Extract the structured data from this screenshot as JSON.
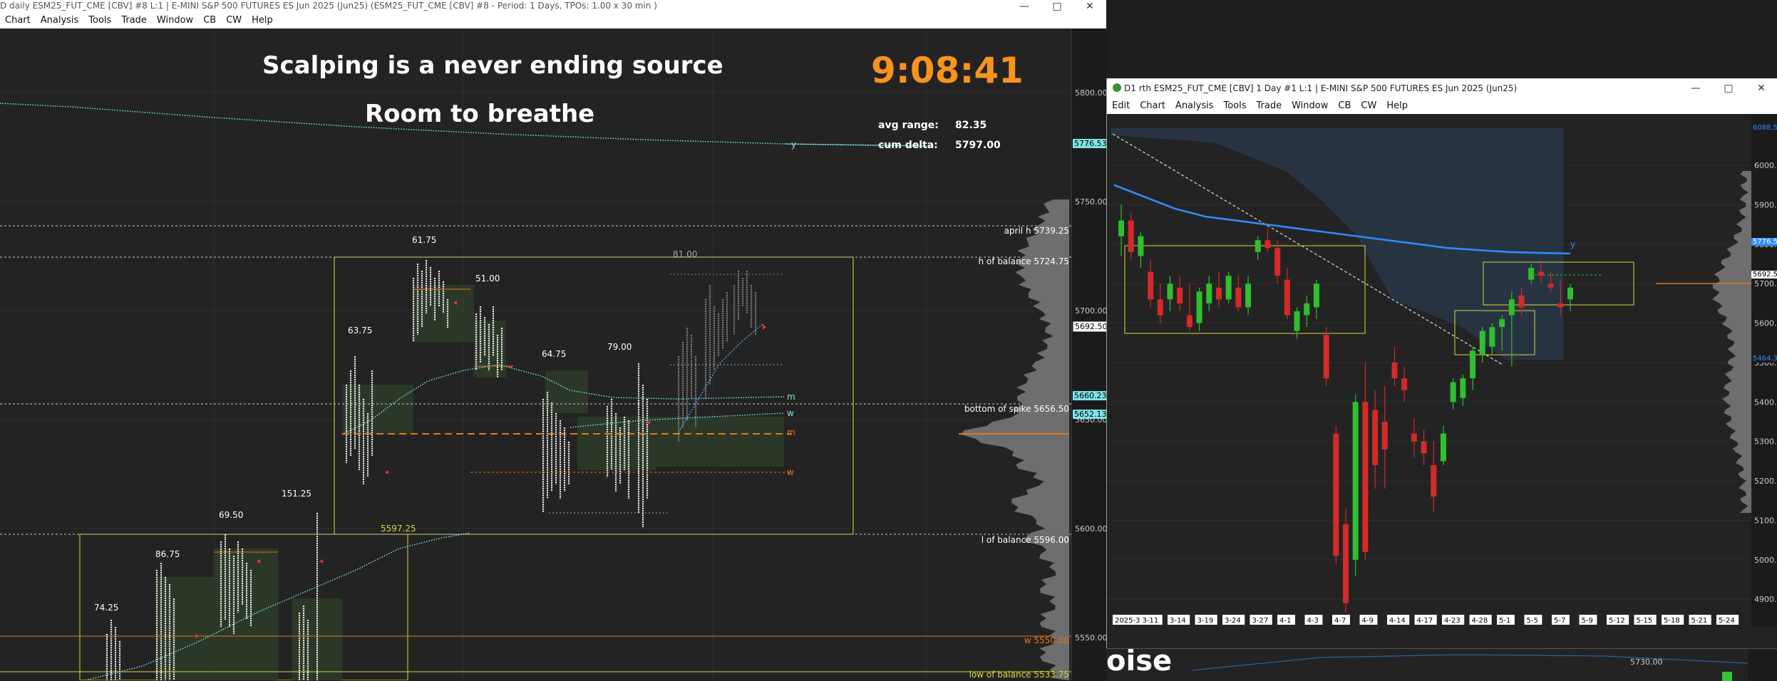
{
  "left_window": {
    "title": "D daily ESM25_FUT_CME [CBV] #8 L:1 | E-MINI S&P 500 FUTURES ES Jun 2025 (Jun25) (ESM25_FUT_CME [CBV] #8 - Period: 1 Days, TPOs: 1.00 x 30 min )",
    "menu": [
      "Chart",
      "Analysis",
      "Tools",
      "Trade",
      "Window",
      "CB",
      "CW",
      "Help"
    ],
    "headline1": "Scalping is a never ending source",
    "headline2": "Room to breathe",
    "clock": "9:08:41",
    "stats": [
      {
        "label": "avg range:",
        "value": "82.35"
      },
      {
        "label": "cum delta:",
        "value": "5797.00"
      }
    ],
    "range_labels": [
      "61.75",
      "51.00",
      "63.75",
      "64.75",
      "79.00",
      "81.00",
      "69.50",
      "86.75",
      "74.25",
      "151.25",
      "5597.25"
    ],
    "level_labels": [
      {
        "text": "april h  5739.25"
      },
      {
        "text": "h of balance  5724.75"
      },
      {
        "text": "bottom of spike  5656.50"
      },
      {
        "text": "l of balance  5596.00"
      },
      {
        "text": "w  5550.00"
      },
      {
        "text": "low of balance  5533.75"
      }
    ],
    "y_ticks": [
      "5800.00",
      "5750.00",
      "5700.00",
      "5650.00",
      "5600.00",
      "5550.00"
    ],
    "price_tags": [
      "5776.53",
      "5692.50",
      "5660.23",
      "5652.13"
    ],
    "line_tags": [
      "y",
      "m",
      "w",
      "m",
      "w"
    ],
    "colors": {
      "accent": "#f7931e",
      "cyan": "#7fe3e8",
      "yellow": "#d8d83a",
      "orange": "#e07a1f"
    }
  },
  "right_window": {
    "title": "D1 rth ESM25_FUT_CME [CBV]  1 Day  #1 L:1 | E-MINI S&P 500 FUTURES ES Jun 2025 (Jun25)",
    "menu": [
      "Edit",
      "Chart",
      "Analysis",
      "Tools",
      "Trade",
      "Window",
      "CB",
      "CW",
      "Help"
    ],
    "y_ticks": [
      "6000.00",
      "5900.00",
      "5800.00",
      "5700.00",
      "5600.00",
      "5500.00",
      "5400.00",
      "5300.00",
      "5200.00",
      "5100.00",
      "5000.00",
      "4900.00"
    ],
    "price_tags": [
      "6088.5",
      "5776.5",
      "5692.5",
      "5464.3"
    ],
    "x_ticks": [
      "2025-3-4",
      "3-11",
      "3-14",
      "3-19",
      "3-24",
      "3-27",
      "4-1",
      "4-3",
      "4-7",
      "4-9",
      "4-14",
      "4-17",
      "4-23",
      "4-28",
      "5-1",
      "5-5",
      "5-7",
      "5-9",
      "5-12",
      "5-15",
      "5-18",
      "5-21",
      "5-24"
    ],
    "line_tag": "y"
  },
  "bottom_fragment": {
    "text": "oise",
    "price": "5730.00"
  },
  "chart_data": [
    {
      "type": "line",
      "title": "D daily ESM25_FUT_CME [CBV] #8",
      "ylim": [
        5530,
        5830
      ],
      "levels": [
        {
          "name": "april h",
          "value": 5739.25
        },
        {
          "name": "h of balance",
          "value": 5724.75
        },
        {
          "name": "bottom of spike",
          "value": 5656.5
        },
        {
          "name": "l of balance",
          "value": 5596.0
        },
        {
          "name": "w",
          "value": 5550.0
        },
        {
          "name": "low of balance",
          "value": 5533.75
        }
      ],
      "price_tags": [
        5776.53,
        5692.5,
        5660.23,
        5652.13
      ]
    },
    {
      "type": "candlestick",
      "title": "D1 rth ESM25_FUT_CME [CBV] 1 Day",
      "ylim": [
        4830,
        6130
      ],
      "candles": [
        {
          "o": 5820,
          "h": 5900,
          "l": 5770,
          "c": 5860
        },
        {
          "o": 5860,
          "h": 5880,
          "l": 5760,
          "c": 5780
        },
        {
          "o": 5770,
          "h": 5830,
          "l": 5740,
          "c": 5820
        },
        {
          "o": 5730,
          "h": 5760,
          "l": 5640,
          "c": 5660
        },
        {
          "o": 5660,
          "h": 5700,
          "l": 5600,
          "c": 5620
        },
        {
          "o": 5660,
          "h": 5720,
          "l": 5630,
          "c": 5700
        },
        {
          "o": 5690,
          "h": 5720,
          "l": 5630,
          "c": 5650
        },
        {
          "o": 5620,
          "h": 5700,
          "l": 5580,
          "c": 5590
        },
        {
          "o": 5600,
          "h": 5690,
          "l": 5580,
          "c": 5680
        },
        {
          "o": 5650,
          "h": 5720,
          "l": 5630,
          "c": 5700
        },
        {
          "o": 5690,
          "h": 5730,
          "l": 5640,
          "c": 5660
        },
        {
          "o": 5660,
          "h": 5730,
          "l": 5650,
          "c": 5720
        },
        {
          "o": 5690,
          "h": 5720,
          "l": 5630,
          "c": 5640
        },
        {
          "o": 5640,
          "h": 5720,
          "l": 5620,
          "c": 5700
        },
        {
          "o": 5780,
          "h": 5820,
          "l": 5760,
          "c": 5810
        },
        {
          "o": 5810,
          "h": 5840,
          "l": 5780,
          "c": 5790
        },
        {
          "o": 5790,
          "h": 5810,
          "l": 5700,
          "c": 5720
        },
        {
          "o": 5710,
          "h": 5740,
          "l": 5610,
          "c": 5620
        },
        {
          "o": 5580,
          "h": 5640,
          "l": 5560,
          "c": 5630
        },
        {
          "o": 5620,
          "h": 5670,
          "l": 5590,
          "c": 5650
        },
        {
          "o": 5640,
          "h": 5710,
          "l": 5610,
          "c": 5700
        },
        {
          "o": 5570,
          "h": 5590,
          "l": 5440,
          "c": 5460
        },
        {
          "o": 5320,
          "h": 5340,
          "l": 4990,
          "c": 5010
        },
        {
          "o": 5090,
          "h": 5130,
          "l": 4830,
          "c": 4890
        },
        {
          "o": 5000,
          "h": 5420,
          "l": 4960,
          "c": 5400
        },
        {
          "o": 5400,
          "h": 5500,
          "l": 5000,
          "c": 5020
        },
        {
          "o": 5380,
          "h": 5430,
          "l": 5180,
          "c": 5240
        },
        {
          "o": 5350,
          "h": 5440,
          "l": 5180,
          "c": 5280
        },
        {
          "o": 5500,
          "h": 5540,
          "l": 5440,
          "c": 5460
        },
        {
          "o": 5460,
          "h": 5490,
          "l": 5400,
          "c": 5430
        },
        {
          "o": 5320,
          "h": 5360,
          "l": 5260,
          "c": 5300
        },
        {
          "o": 5300,
          "h": 5330,
          "l": 5240,
          "c": 5270
        },
        {
          "o": 5240,
          "h": 5300,
          "l": 5120,
          "c": 5160
        },
        {
          "o": 5250,
          "h": 5340,
          "l": 5240,
          "c": 5320
        },
        {
          "o": 5400,
          "h": 5460,
          "l": 5380,
          "c": 5450
        },
        {
          "o": 5410,
          "h": 5470,
          "l": 5390,
          "c": 5460
        },
        {
          "o": 5460,
          "h": 5540,
          "l": 5430,
          "c": 5530
        },
        {
          "o": 5520,
          "h": 5590,
          "l": 5500,
          "c": 5580
        },
        {
          "o": 5540,
          "h": 5600,
          "l": 5520,
          "c": 5590
        },
        {
          "o": 5590,
          "h": 5620,
          "l": 5530,
          "c": 5610
        },
        {
          "o": 5620,
          "h": 5680,
          "l": 5490,
          "c": 5660
        },
        {
          "o": 5670,
          "h": 5690,
          "l": 5620,
          "c": 5640
        },
        {
          "o": 5710,
          "h": 5750,
          "l": 5700,
          "c": 5740
        },
        {
          "o": 5730,
          "h": 5760,
          "l": 5700,
          "c": 5720
        },
        {
          "o": 5700,
          "h": 5730,
          "l": 5680,
          "c": 5690
        },
        {
          "o": 5650,
          "h": 5710,
          "l": 5620,
          "c": 5640
        },
        {
          "o": 5660,
          "h": 5700,
          "l": 5630,
          "c": 5690
        }
      ],
      "ma_line": [
        5950,
        5920,
        5890,
        5870,
        5860,
        5850,
        5840,
        5830,
        5820,
        5810,
        5800,
        5790,
        5785,
        5780,
        5778,
        5776
      ]
    }
  ]
}
